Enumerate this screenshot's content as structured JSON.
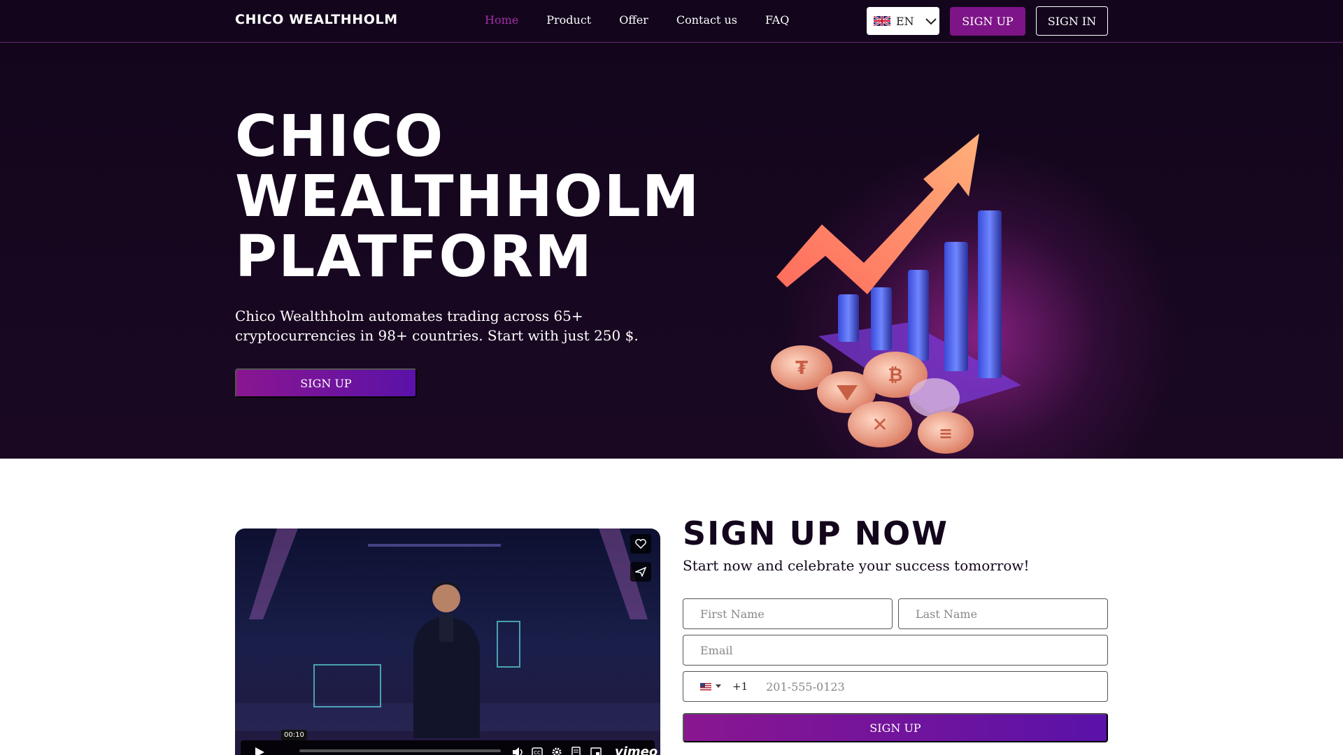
{
  "nav": {
    "logo": "CHICO WEALTHHOLM",
    "menu": [
      {
        "label": "Home",
        "active": true
      },
      {
        "label": "Product"
      },
      {
        "label": "Offer"
      },
      {
        "label": "Contact us"
      },
      {
        "label": "FAQ"
      }
    ],
    "language": {
      "code": "EN",
      "flag_icon": "uk-flag-icon"
    },
    "signup_label": "SIGN UP",
    "signin_label": "SIGN IN"
  },
  "hero": {
    "title_lines": [
      "CHICO",
      "WEALTHHOLM",
      "PLATFORM"
    ],
    "description": "Chico Wealthholm automates trading across 65+ cryptocurrencies in 98+ countries. Start with just 250 $.",
    "cta_label": "SIGN UP"
  },
  "video": {
    "timestamp": "00:10",
    "brand": "vimeo"
  },
  "signup_form": {
    "title": "SIGN UP NOW",
    "subtitle": "Start now and celebrate your success tomorrow!",
    "first_name_placeholder": "First Name",
    "last_name_placeholder": "Last Name",
    "email_placeholder": "Email",
    "phone_code": "+1",
    "phone_placeholder": "201-555-0123",
    "submit_label": "SIGN UP"
  },
  "colors": {
    "background_dark": "#13061c",
    "accent_purple": "#7d1487",
    "active_link": "#a42ea8"
  }
}
